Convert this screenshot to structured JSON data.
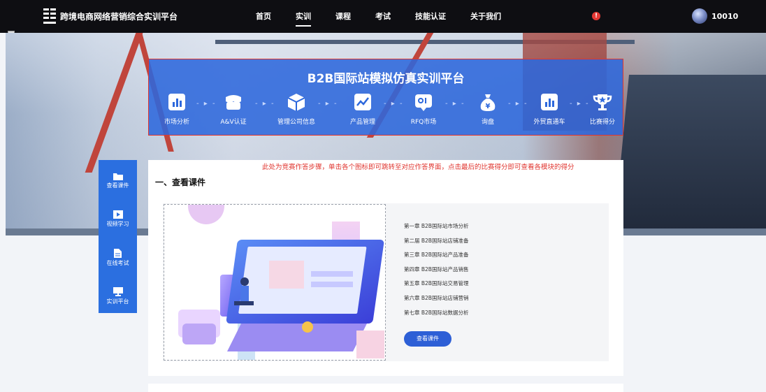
{
  "app": {
    "title": "跨境电商网络营销综合实训平台"
  },
  "nav": {
    "items": [
      {
        "label": "首页",
        "active": false
      },
      {
        "label": "实训",
        "active": true
      },
      {
        "label": "课程",
        "active": false
      },
      {
        "label": "考试",
        "active": false
      },
      {
        "label": "技能认证",
        "active": false
      },
      {
        "label": "关于我们",
        "active": false
      }
    ],
    "alert_icon": "alert-circle-icon",
    "user_id": "10010"
  },
  "banner": {
    "title": "B2B国际站模拟仿真实训平台",
    "steps": [
      {
        "label": "市场分析",
        "icon": "bar-chart-icon"
      },
      {
        "label": "A&V认证",
        "icon": "storefront-icon"
      },
      {
        "label": "管理公司信息",
        "icon": "cube-icon"
      },
      {
        "label": "产品管理",
        "icon": "trend-line-icon"
      },
      {
        "label": "RFQ市场",
        "icon": "rfq-chat-icon"
      },
      {
        "label": "询盘",
        "icon": "money-bag-icon"
      },
      {
        "label": "外贸直通车",
        "icon": "bar-chart-icon"
      },
      {
        "label": "比赛得分",
        "icon": "trophy-icon"
      }
    ]
  },
  "sidemenu": {
    "items": [
      {
        "label": "查看课件",
        "icon": "folder-icon"
      },
      {
        "label": "视频学习",
        "icon": "video-icon"
      },
      {
        "label": "在线考试",
        "icon": "document-icon"
      },
      {
        "label": "实训平台",
        "icon": "monitor-icon"
      }
    ]
  },
  "main": {
    "notice": "此处为竞赛作答步骤，单击各个图标即可跳转至对应作答界面，点击最后的比赛得分即可查看各模块的得分",
    "section_title": "一、查看课件",
    "chapters": [
      "第一章 B2B国际站市场分析",
      "第二届 B2B国际站店铺准备",
      "第三章 B2B国际站产品准备",
      "第四章 B2B国际站产品销售",
      "第五章 B2B国际站交易管理",
      "第六章 B2B国际站店铺营销",
      "第七章 B2B国际站数据分析"
    ],
    "view_button": "查看课件"
  },
  "colors": {
    "topbar": "#0e0e12",
    "banner_blue": "#2d68dc",
    "side_blue": "#2b6fe0",
    "notice_red": "#e0352f",
    "button_blue": "#2d5fd6"
  }
}
